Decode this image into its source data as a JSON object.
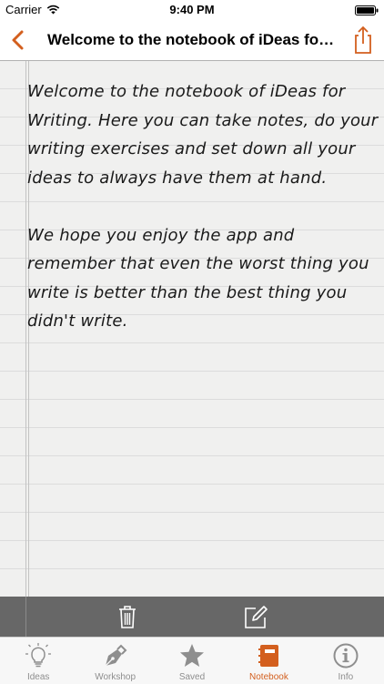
{
  "colors": {
    "accent": "#d35f1e",
    "tab_inactive": "#8e8e8e",
    "toolbar": "#676767",
    "paper": "#f0f0ef"
  },
  "status_bar": {
    "carrier": "Carrier",
    "time": "9:40 PM",
    "icons": [
      "wifi-icon",
      "battery-icon"
    ]
  },
  "nav": {
    "title": "Welcome to the notebook of iDeas for Writing",
    "back_icon": "chevron-left-icon",
    "share_icon": "share-icon"
  },
  "note": {
    "paragraphs": [
      "Welcome to the notebook of iDeas for Writing. Here you can take notes, do your writing exercises and set down all your ideas to always have them at hand.",
      "We hope you enjoy the app and remember that even the worst thing you write is better than the best thing you didn't write."
    ]
  },
  "toolbar": {
    "icons": [
      "trash-icon",
      "compose-icon"
    ]
  },
  "tabs": [
    {
      "label": "Ideas",
      "icon": "lightbulb-icon",
      "active": false
    },
    {
      "label": "Workshop",
      "icon": "pen-nib-icon",
      "active": false
    },
    {
      "label": "Saved",
      "icon": "star-icon",
      "active": false
    },
    {
      "label": "Notebook",
      "icon": "notebook-icon",
      "active": true
    },
    {
      "label": "Info",
      "icon": "info-icon",
      "active": false
    }
  ]
}
